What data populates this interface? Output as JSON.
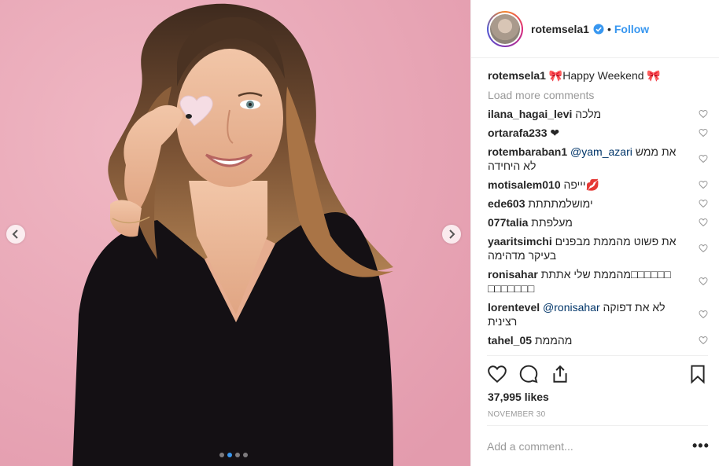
{
  "post": {
    "username": "rotemsela1",
    "separator": "•",
    "follow_label": "Follow",
    "caption_user": "rotemsela1",
    "caption_text": "🎀Happy Weekend 🎀",
    "load_more": "Load more comments",
    "comments": [
      {
        "user": "ilana_hagai_levi",
        "text": "מלכה"
      },
      {
        "user": "ortarafa233",
        "text": "❤"
      },
      {
        "user": "rotembaraban1",
        "mention": "@yam_azari",
        "text": "את ממש",
        "text2": "לא היחידה"
      },
      {
        "user": "motisalem010",
        "text": "יייפה💋"
      },
      {
        "user": "ede603",
        "text": "ימושלמתתתת"
      },
      {
        "user": "077talia",
        "text": "מעלפתת"
      },
      {
        "user": "yaaritsimchi",
        "text": "את פשוט מהממת מבפנים",
        "text2": "בעיקר מדהימה"
      },
      {
        "user": "ronisahar",
        "text": "מהממת שלי אתתת□□□□□□",
        "text2": "□□□□□□□"
      },
      {
        "user": "lorentevel",
        "mention": "@ronisahar",
        "text": "לא את דפוקה",
        "text2": "רצינית"
      },
      {
        "user": "tahel_05",
        "text": "מהממת"
      }
    ],
    "likes": "37,995 likes",
    "date": "NOVEMBER 30",
    "add_comment_placeholder": "Add a comment...",
    "more_label": "•••",
    "carousel": {
      "count": 4,
      "active": 2
    },
    "colors": {
      "accent": "#3897f0",
      "background_pink": "#e9a9b8",
      "mention": "#003569"
    },
    "icons": [
      "chevron-left-icon",
      "chevron-right-icon",
      "verified-icon",
      "heart-icon",
      "comment-icon",
      "share-icon",
      "bookmark-icon"
    ]
  }
}
